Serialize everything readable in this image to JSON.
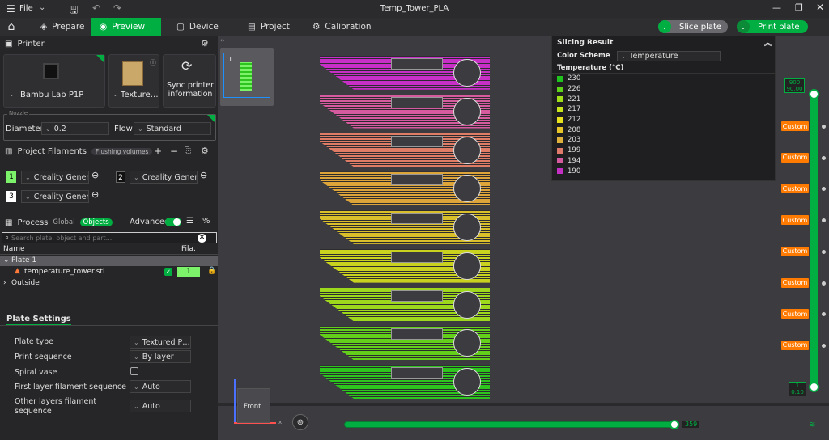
{
  "window": {
    "file_menu": "File",
    "title": "Temp_Tower_PLA"
  },
  "tabs": [
    {
      "label": "Prepare"
    },
    {
      "label": "Preview"
    },
    {
      "label": "Device"
    },
    {
      "label": "Project"
    },
    {
      "label": "Calibration"
    }
  ],
  "actions": {
    "slice": "Slice plate",
    "print": "Print plate"
  },
  "printer": {
    "section": "Printer",
    "name": "Bambu Lab P1P",
    "plate": "Texture…",
    "sync": "Sync printer information",
    "nozzle_label": "Nozzle",
    "diameter_label": "Diameter",
    "diameter": "0.2",
    "flow_label": "Flow",
    "flow": "Standard"
  },
  "filaments": {
    "section": "Project Filaments",
    "flushing": "Flushing volumes",
    "items": [
      {
        "num": "1",
        "name": "Creality Gener…",
        "color": "#7cf26a"
      },
      {
        "num": "2",
        "name": "Creality Gener…",
        "color": "#111111"
      },
      {
        "num": "3",
        "name": "Creality Gener…",
        "color": "#ffffff"
      }
    ]
  },
  "process": {
    "section": "Process",
    "global": "Global",
    "objects": "Objects",
    "advanced": "Advanced",
    "search_placeholder": "Search plate, object and part...",
    "col_name": "Name",
    "col_fila": "Fila.",
    "plate": "Plate 1",
    "object": "temperature_tower.stl",
    "object_fila": "1",
    "outside": "Outside"
  },
  "plate_settings": {
    "title": "Plate Settings",
    "rows": [
      {
        "label": "Plate type",
        "value": "Textured P…"
      },
      {
        "label": "Print sequence",
        "value": "By layer"
      },
      {
        "label": "Spiral vase",
        "value": ""
      },
      {
        "label": "First layer filament sequence",
        "value": "Auto"
      },
      {
        "label": "Other layers filament sequence",
        "value": "Auto"
      }
    ]
  },
  "thumb": {
    "label": "1"
  },
  "slicing": {
    "title": "Slicing Result",
    "scheme_label": "Color Scheme",
    "scheme": "Temperature",
    "legend_title": "Temperature (°C)",
    "legend": [
      {
        "t": "230",
        "c": "#22c21e"
      },
      {
        "t": "226",
        "c": "#5fd21a"
      },
      {
        "t": "221",
        "c": "#9fe01a"
      },
      {
        "t": "217",
        "c": "#c9e61c"
      },
      {
        "t": "212",
        "c": "#e8e21e"
      },
      {
        "t": "208",
        "c": "#e8c62a"
      },
      {
        "t": "203",
        "c": "#e0b23c"
      },
      {
        "t": "199",
        "c": "#e07a6a"
      },
      {
        "t": "194",
        "c": "#d65aa0"
      },
      {
        "t": "190",
        "c": "#c42fc4"
      }
    ]
  },
  "layer_slider": {
    "top_layer": "900",
    "top_height": "90.00",
    "bottom_layer": "1",
    "bottom_height": "0.10",
    "custom": "Custom"
  },
  "move_slider": {
    "value": "359"
  },
  "view": {
    "front": "Front"
  },
  "tower": {
    "bands": [
      "#c72fc6",
      "#d65a9e",
      "#df7c66",
      "#dda43a",
      "#d9bf2a",
      "#c9d31f",
      "#9dd81c",
      "#63cf1a",
      "#2ec41e"
    ]
  }
}
